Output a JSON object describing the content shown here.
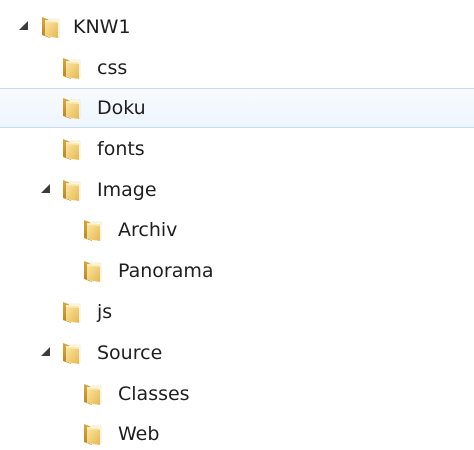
{
  "tree": {
    "items": [
      {
        "label": "KNW1",
        "expanded": true,
        "level": 0
      },
      {
        "label": "css",
        "level": 1
      },
      {
        "label": "Doku",
        "level": 1,
        "hovered": true
      },
      {
        "label": "fonts",
        "level": 1
      },
      {
        "label": "Image",
        "expanded": true,
        "level": 1
      },
      {
        "label": "Archiv",
        "level": 2
      },
      {
        "label": "Panorama",
        "level": 2
      },
      {
        "label": "js",
        "level": 1
      },
      {
        "label": "Source",
        "expanded": true,
        "level": 1
      },
      {
        "label": "Classes",
        "level": 2
      },
      {
        "label": "Web",
        "level": 2
      }
    ]
  },
  "colors": {
    "folder_front": "#f3d27a",
    "folder_back": "#c8962e",
    "hover_border": "#c5dcf2",
    "expander": "#3c3c3c"
  }
}
